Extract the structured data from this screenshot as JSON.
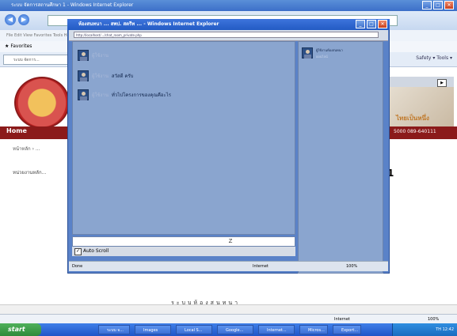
{
  "ie": {
    "title": "ระบบ จัดการสถานศึกษา 1 - Windows Internet Explorer",
    "menu_items": "File   Edit   View   Favorites   Tools   Help",
    "favorites_label": "Favorites",
    "tab_label": "ระบบ จัดการ...",
    "tools_right": "Safety ▾   Tools ▾",
    "status_zone": "Internet",
    "status_zoom": "100%"
  },
  "page": {
    "home_label": "Home",
    "phone": "5000   089-640111",
    "crumb": "หน้าหลัก › ...",
    "left_label": "หน่วยงานหลัก...",
    "big_number": "1",
    "right_brand": "ไทยเป็นหนึ่ง",
    "right_menu": "Safety ▾  Tools ▾"
  },
  "popup": {
    "title": "ห้องสนทนา ... สพป. สตรีท ... - Windows Internet Explorer",
    "address": "http://localhost/.../chat_room_private.php",
    "messages": [
      {
        "user": "ผู้ใช้งาน",
        "text": ""
      },
      {
        "user": "ผู้ใช้งาน",
        "text": "สวัสดี ครับ"
      },
      {
        "user": "ผู้ใช้งาน",
        "text": "ทั่วไปโครงการของคุณคือะไร"
      }
    ],
    "online_users": [
      {
        "name": "ผู้ใช้งานห้องสนทนา",
        "status": "ออนไลน์"
      }
    ],
    "send_icon": "Z",
    "autoscroll_label": "Auto Scroll",
    "status_done": "Done",
    "status_zone": "Internet",
    "status_zoom": "100%"
  },
  "taskbar": {
    "start_label": "start",
    "buttons": [
      "ระบบ จ...",
      "Images",
      "Local S...",
      "Google...",
      "Internet...",
      "Micros...",
      "Export..."
    ],
    "tray_time": "TH 12:42"
  },
  "caption": "ระบบห้องสนทนา"
}
